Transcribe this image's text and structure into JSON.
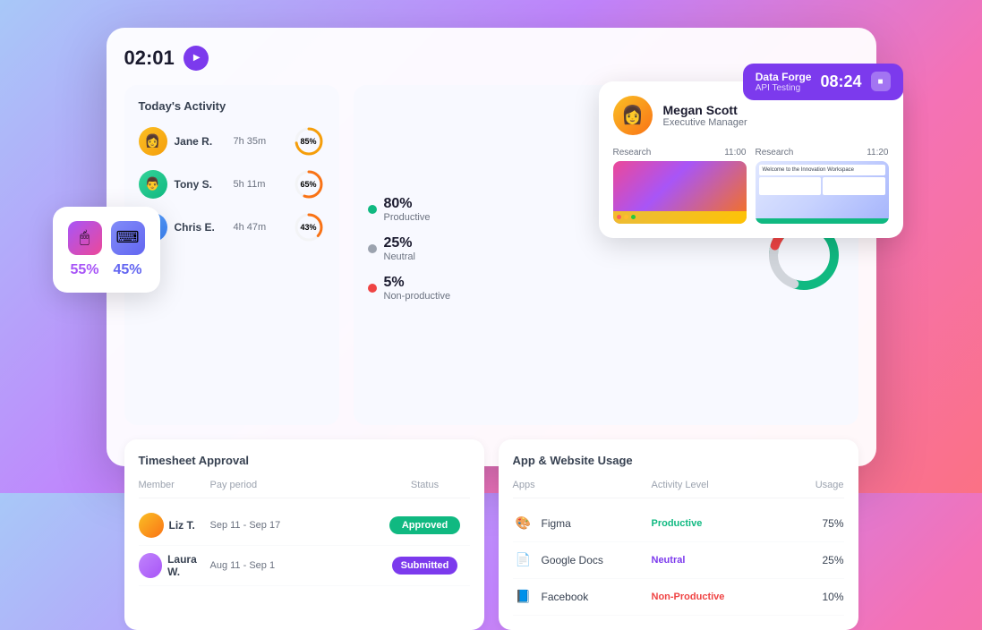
{
  "timer": {
    "value": "02:01",
    "play_label": "play"
  },
  "input_card": {
    "mouse_pct": "55%",
    "keyboard_pct": "45%",
    "mouse_icon": "🖱",
    "keyboard_icon": "⌨"
  },
  "activity": {
    "title": "Today's Activity",
    "members": [
      {
        "name": "Jane R.",
        "time": "7h 35m",
        "pct": "85%",
        "pct_num": 85,
        "color": "#f59e0b"
      },
      {
        "name": "Tony S.",
        "time": "5h 11m",
        "pct": "65%",
        "pct_num": 65,
        "color": "#f97316"
      },
      {
        "name": "Chris E.",
        "time": "4h 47m",
        "pct": "43%",
        "pct_num": 43,
        "color": "#f97316"
      }
    ]
  },
  "productivity": {
    "stats": [
      {
        "pct": "80%",
        "label": "Productive",
        "dot": "green"
      },
      {
        "pct": "25%",
        "label": "Neutral",
        "dot": "gray"
      },
      {
        "pct": "5%",
        "label": "Non-productive",
        "dot": "red"
      }
    ]
  },
  "profile": {
    "name": "Megan Scott",
    "role": "Executive Manager",
    "avatar_emoji": "👩"
  },
  "timer_badge": {
    "title": "Data Forge",
    "subtitle": "API Testing",
    "time": "08:24"
  },
  "screenshots": [
    {
      "label": "Research",
      "time": "11:00"
    },
    {
      "label": "Research",
      "time": "11:20"
    }
  ],
  "timesheet": {
    "title": "Timesheet Approval",
    "columns": [
      "Member",
      "Pay period",
      "Status"
    ],
    "rows": [
      {
        "name": "Liz T.",
        "period": "Sep 11 - Sep 17",
        "status": "Approved",
        "status_type": "approved"
      },
      {
        "name": "Laura W.",
        "period": "Aug 11 - Sep 1",
        "status": "Submitted",
        "status_type": "submitted"
      }
    ]
  },
  "app_usage": {
    "title": "App & Website Usage",
    "columns": [
      "Apps",
      "Activity Level",
      "Usage"
    ],
    "rows": [
      {
        "name": "Figma",
        "icon": "🎨",
        "activity": "Productive",
        "activity_type": "productive",
        "usage": "75%"
      },
      {
        "name": "Google Docs",
        "icon": "📄",
        "activity": "Neutral",
        "activity_type": "neutral",
        "usage": "25%"
      },
      {
        "name": "Facebook",
        "icon": "📘",
        "activity": "Non-Productive",
        "activity_type": "nonproductive",
        "usage": "10%"
      }
    ]
  }
}
